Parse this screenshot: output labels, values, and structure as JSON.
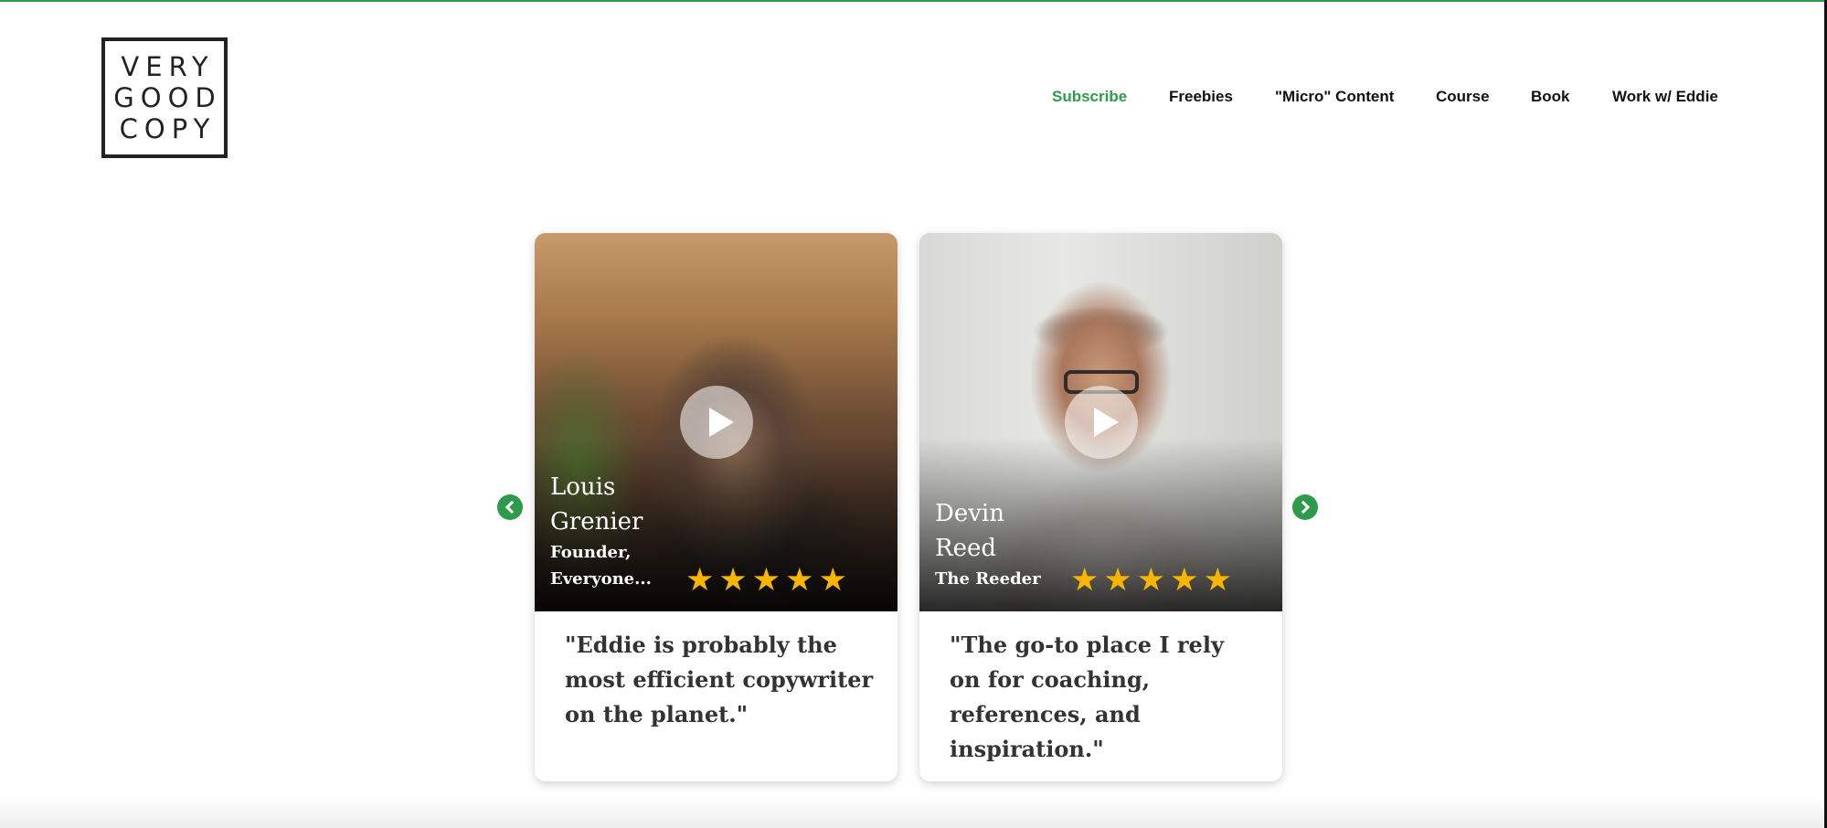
{
  "logo": {
    "lines": [
      "VERY",
      "GOOD",
      "COPY"
    ]
  },
  "nav": {
    "items": [
      {
        "label": "Subscribe"
      },
      {
        "label": "Freebies"
      },
      {
        "label": "\"Micro\" Content"
      },
      {
        "label": "Course"
      },
      {
        "label": "Book"
      },
      {
        "label": "Work w/ Eddie"
      }
    ],
    "active_color": "#2e9b4c"
  },
  "testimonials": [
    {
      "name_lines": [
        "Louis",
        "Grenier"
      ],
      "role_lines": [
        "Founder,",
        "Everyone..."
      ],
      "rating": 5,
      "quote": "\"Eddie is probably the most efficient copywriter on the planet.\""
    },
    {
      "name_lines": [
        "Devin",
        "Reed"
      ],
      "role_lines": [
        "The Reeder"
      ],
      "rating": 5,
      "quote": "\"The go-to place I rely on for coaching, references, and inspiration.\""
    }
  ],
  "icons": {
    "play": "play-icon",
    "star": "star-icon",
    "prev": "chevron-left-icon",
    "next": "chevron-right-icon"
  },
  "colors": {
    "accent": "#2e9b4c",
    "star": "#f7b500"
  }
}
